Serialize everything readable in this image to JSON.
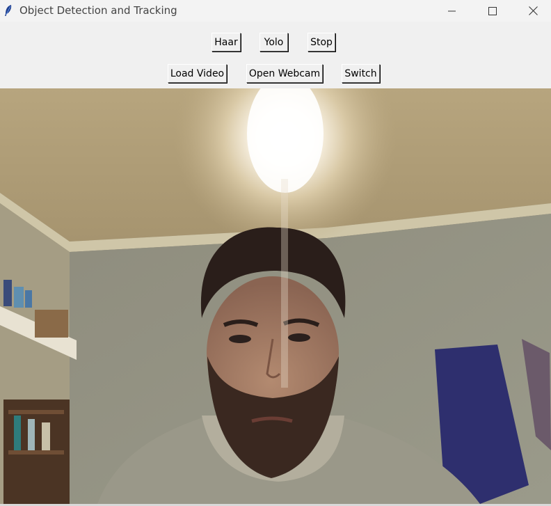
{
  "window": {
    "title": "Object Detection and Tracking",
    "icon": "feather-icon",
    "controls": [
      "minimize-icon",
      "maximize-icon",
      "close-icon"
    ]
  },
  "toolbar": {
    "row1": [
      {
        "id": "haar",
        "label": "Haar"
      },
      {
        "id": "yolo",
        "label": "Yolo"
      },
      {
        "id": "stop",
        "label": "Stop"
      }
    ],
    "row2": [
      {
        "id": "load",
        "label": "Load Video"
      },
      {
        "id": "webcam",
        "label": "Open Webcam"
      },
      {
        "id": "switch",
        "label": "Switch"
      }
    ]
  },
  "video": {
    "content": "webcam-frame"
  }
}
